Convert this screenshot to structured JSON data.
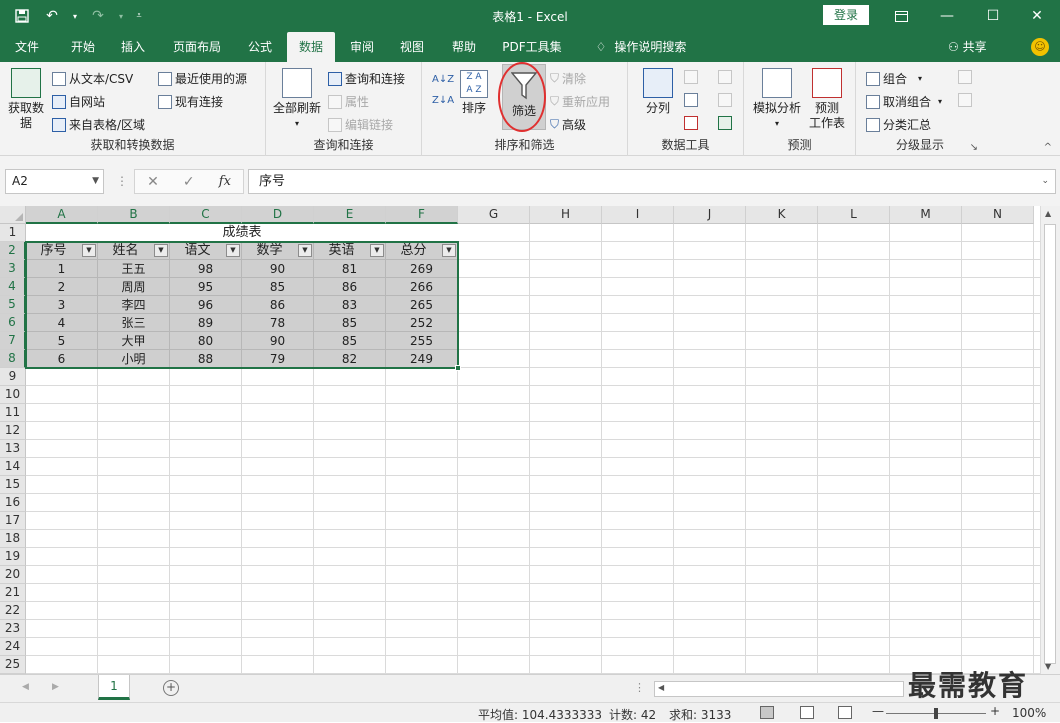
{
  "window": {
    "title": "表格1  -  Excel",
    "login_label": "登录",
    "save_icon": "save-icon",
    "undo_icon": "undo-icon",
    "redo_icon": "redo-icon"
  },
  "tabs": [
    {
      "label": "文件"
    },
    {
      "label": "开始"
    },
    {
      "label": "插入"
    },
    {
      "label": "页面布局"
    },
    {
      "label": "公式"
    },
    {
      "label": "数据",
      "active": true
    },
    {
      "label": "审阅"
    },
    {
      "label": "视图"
    },
    {
      "label": "帮助"
    },
    {
      "label": "PDF工具集"
    },
    {
      "label": "操作说明搜索"
    }
  ],
  "share_label": "共享",
  "ribbon": {
    "get_data": {
      "big_label_1": "获取数",
      "big_label_2": "据",
      "from_text": "从文本/CSV",
      "from_web": "自网站",
      "from_table": "来自表格/区域",
      "recent_sources": "最近使用的源",
      "existing_conn": "现有连接",
      "group_label": "获取和转换数据"
    },
    "queries": {
      "refresh_all": "全部刷新",
      "queries_conn": "查询和连接",
      "properties": "属性",
      "edit_links": "编辑链接",
      "group_label": "查询和连接"
    },
    "sort_filter": {
      "sort": "排序",
      "filter": "筛选",
      "clear": "清除",
      "reapply": "重新应用",
      "advanced": "高级",
      "group_label": "排序和筛选"
    },
    "data_tools": {
      "text_to_columns": "分列",
      "group_label": "数据工具"
    },
    "forecast": {
      "what_if": "模拟分析",
      "forecast_sheet_1": "预测",
      "forecast_sheet_2": "工作表",
      "group_label": "预测"
    },
    "outline": {
      "group": "组合",
      "ungroup": "取消组合",
      "subtotal": "分类汇总",
      "group_label": "分级显示"
    }
  },
  "formula_bar": {
    "name_box": "A2",
    "content": "序号"
  },
  "columns": [
    "A",
    "B",
    "C",
    "D",
    "E",
    "F",
    "G",
    "H",
    "I",
    "J",
    "K",
    "L",
    "M",
    "N"
  ],
  "rows": [
    "1",
    "2",
    "3",
    "4",
    "5",
    "6",
    "7",
    "8",
    "9",
    "10",
    "11",
    "12",
    "13",
    "14",
    "15",
    "16",
    "17",
    "18",
    "19",
    "20",
    "21",
    "22",
    "23",
    "24",
    "25"
  ],
  "table": {
    "title": "成绩表",
    "headers": [
      "序号",
      "姓名",
      "语文",
      "数学",
      "英语",
      "总分"
    ],
    "rows": [
      [
        "1",
        "王五",
        "98",
        "90",
        "81",
        "269"
      ],
      [
        "2",
        "周周",
        "95",
        "85",
        "86",
        "266"
      ],
      [
        "3",
        "李四",
        "96",
        "86",
        "83",
        "265"
      ],
      [
        "4",
        "张三",
        "89",
        "78",
        "85",
        "252"
      ],
      [
        "5",
        "大甲",
        "80",
        "90",
        "85",
        "255"
      ],
      [
        "6",
        "小明",
        "88",
        "79",
        "82",
        "249"
      ]
    ]
  },
  "sheet_tab": "1",
  "status": {
    "average": "平均值: 104.4333333",
    "count": "计数: 42",
    "sum": "求和: 3133",
    "zoom": "100%"
  },
  "watermark": "最需教育",
  "colors": {
    "excel_green": "#217346",
    "highlight_red": "#e03030"
  }
}
